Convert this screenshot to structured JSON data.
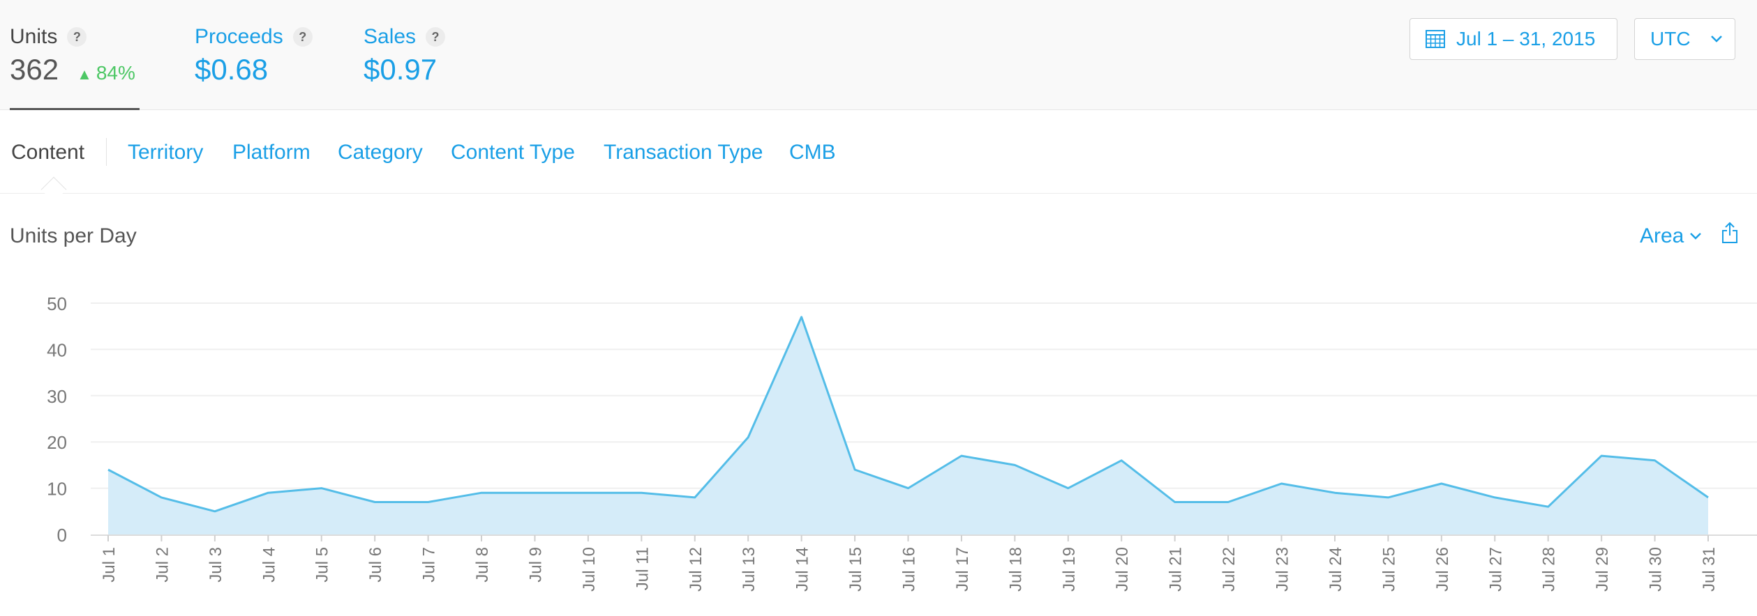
{
  "metrics": {
    "units": {
      "label": "Units",
      "value": "362",
      "delta": "84%"
    },
    "proceeds": {
      "label": "Proceeds",
      "value": "$0.68"
    },
    "sales": {
      "label": "Sales",
      "value": "$0.97"
    }
  },
  "help_glyph": "?",
  "date_range": "Jul 1 – 31, 2015",
  "timezone": "UTC",
  "tabs": [
    {
      "label": "Content"
    },
    {
      "label": "Territory"
    },
    {
      "label": "Platform"
    },
    {
      "label": "Category"
    },
    {
      "label": "Content Type"
    },
    {
      "label": "Transaction Type"
    },
    {
      "label": "CMB"
    }
  ],
  "chart_type_selector": "Area",
  "colors": {
    "accent": "#1a9fe6",
    "positive": "#4cc764",
    "area_stroke": "#54bde8",
    "area_fill": "#d5ecf9"
  },
  "chart_data": {
    "type": "area",
    "title": "Units per Day",
    "xlabel": "",
    "ylabel": "",
    "ylim": [
      0,
      50
    ],
    "yticks": [
      0,
      10,
      20,
      30,
      40,
      50
    ],
    "grid": true,
    "legend": "none",
    "categories": [
      "Jul 1",
      "Jul 2",
      "Jul 3",
      "Jul 4",
      "Jul 5",
      "Jul 6",
      "Jul 7",
      "Jul 8",
      "Jul 9",
      "Jul 10",
      "Jul 11",
      "Jul 12",
      "Jul 13",
      "Jul 14",
      "Jul 15",
      "Jul 16",
      "Jul 17",
      "Jul 18",
      "Jul 19",
      "Jul 20",
      "Jul 21",
      "Jul 22",
      "Jul 23",
      "Jul 24",
      "Jul 25",
      "Jul 26",
      "Jul 27",
      "Jul 28",
      "Jul 29",
      "Jul 30",
      "Jul 31"
    ],
    "values": [
      14,
      8,
      5,
      9,
      10,
      7,
      7,
      9,
      9,
      9,
      9,
      8,
      21,
      47,
      14,
      10,
      17,
      15,
      10,
      16,
      7,
      7,
      11,
      9,
      8,
      11,
      8,
      6,
      17,
      16,
      8
    ]
  }
}
